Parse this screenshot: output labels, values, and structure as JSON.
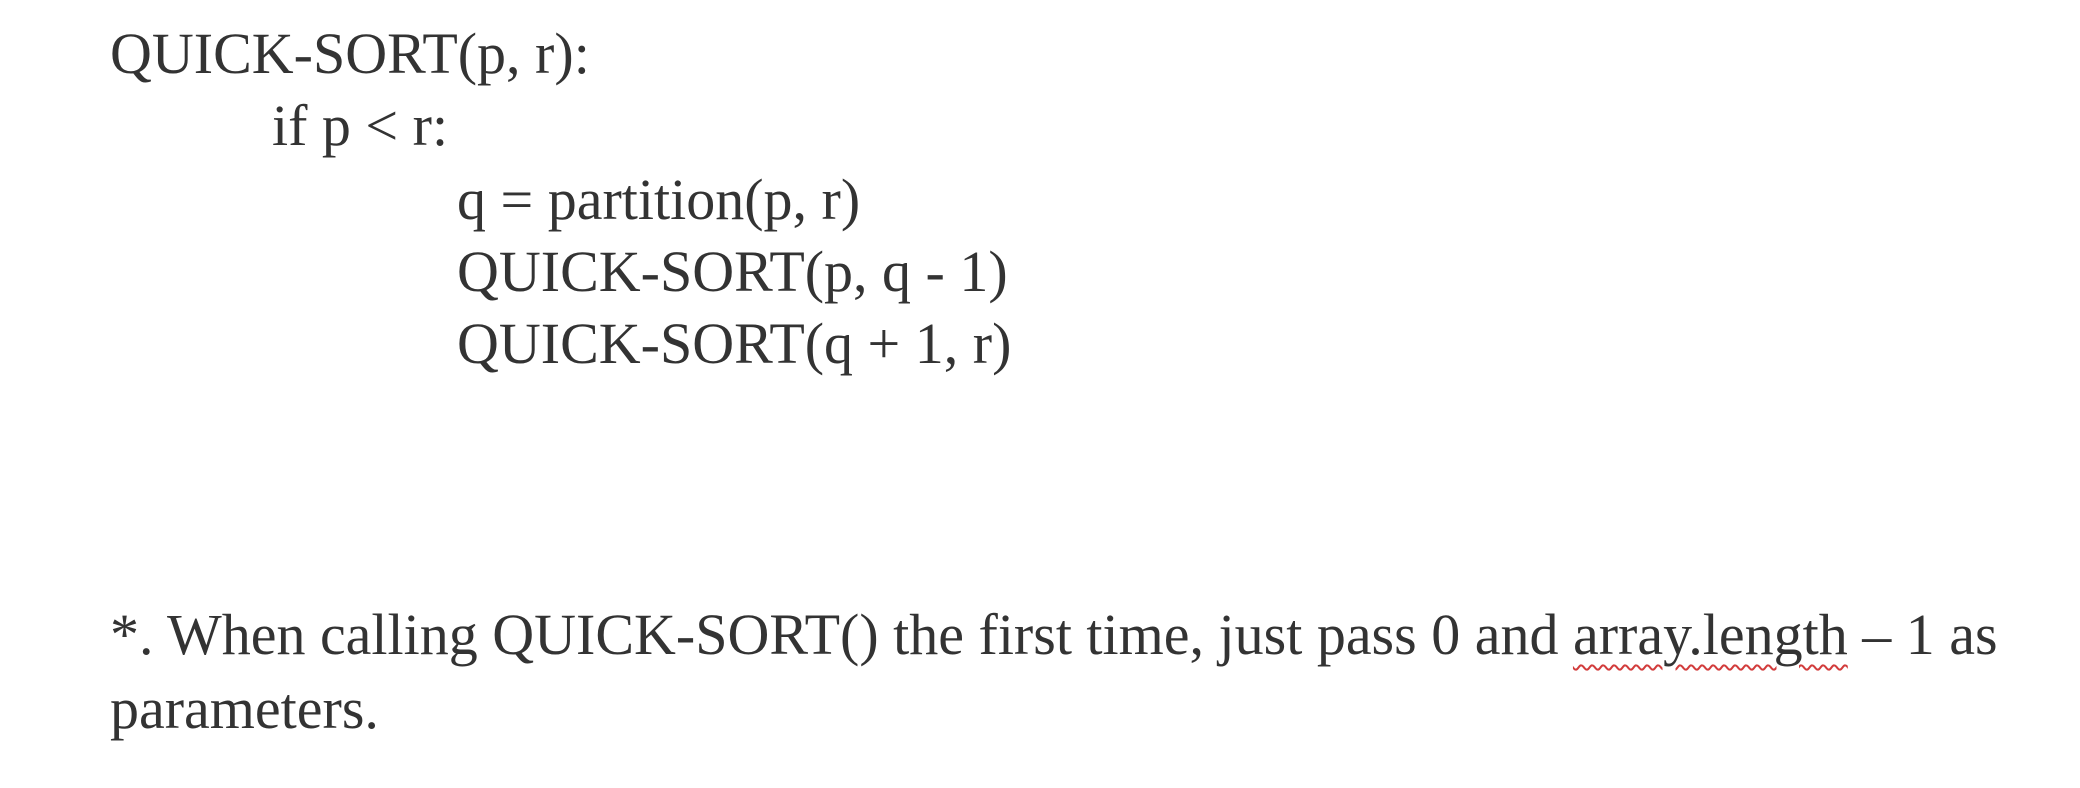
{
  "code": {
    "lines": [
      "QUICK-SORT(p, r):",
      "if p < r:",
      "q = partition(p, r)",
      "QUICK-SORT(p, q - 1)",
      "QUICK-SORT(q + 1, r)"
    ]
  },
  "note": {
    "line1_before": "*. When calling QUICK-SORT() the first time, just pass 0 and ",
    "line1_spellcheck_word": "array.length",
    "line1_after": " – 1 as",
    "line2": "parameters."
  },
  "colors": {
    "text": "#333333",
    "spellcheck_underline": "#d23c3c"
  }
}
